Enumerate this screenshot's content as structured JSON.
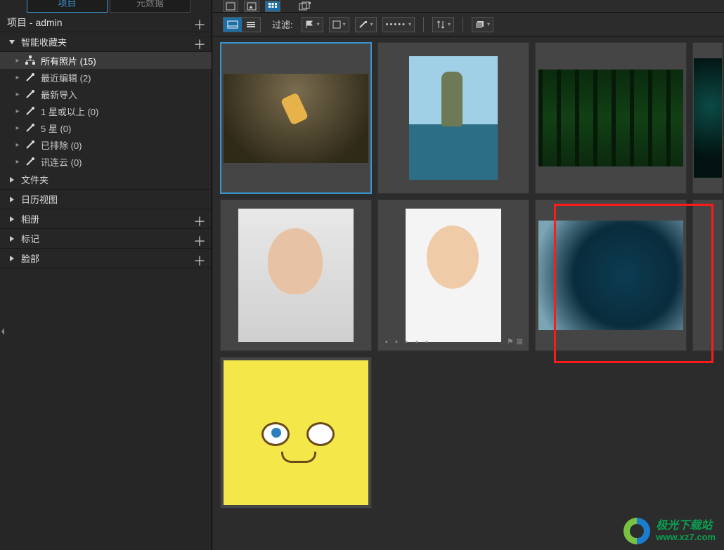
{
  "tabs": {
    "project": "项目",
    "metadata": "元数据"
  },
  "project_bar": {
    "label": "项目 - admin"
  },
  "smart_collection_label": "智能收藏夹",
  "tree": {
    "all_photos": "所有照片 (15)",
    "recent_edit": "最近编辑 (2)",
    "recent_import": "最新导入",
    "one_star": "1 星或以上 (0)",
    "five_star": "5 星 (0)",
    "excluded": "已排除 (0)",
    "cloud": "讯连云 (0)"
  },
  "sections": {
    "folders": "文件夹",
    "calendar": "日历视图",
    "albums": "相册",
    "tags": "标记",
    "faces": "脸部"
  },
  "toolbar": {
    "filter_label": "过滤:"
  },
  "watermark": {
    "line1": "极光下载站",
    "line2": "www.xz7.com"
  },
  "icons": {
    "thumb_info": "thumb-info-icon",
    "list_lines": "list-lines-icon",
    "flag": "flag-icon",
    "square": "square-icon",
    "brush": "brush-icon",
    "dots": "dots-icon",
    "sort": "sort-icon",
    "stack": "stack-icon"
  }
}
